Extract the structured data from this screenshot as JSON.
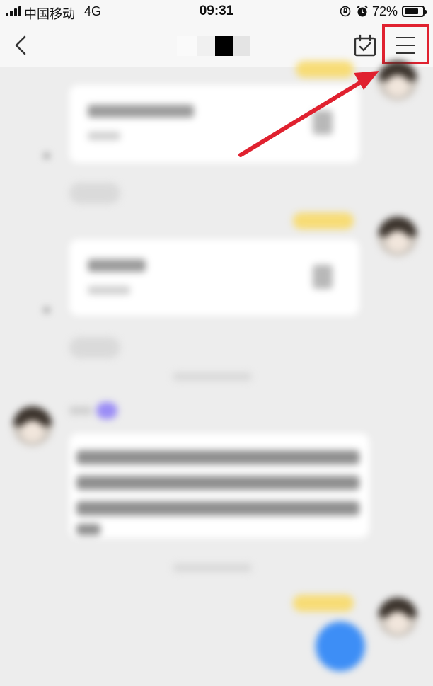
{
  "status_bar": {
    "carrier": "中国移动",
    "network": "4G",
    "time": "09:31",
    "battery": "72%",
    "battery_level": 0.72,
    "icons": [
      "signal-icon",
      "rotation-lock-icon",
      "alarm-icon",
      "battery-icon"
    ]
  },
  "nav_bar": {
    "back_icon": "chevron-left-icon",
    "calendar_icon": "calendar-check-icon",
    "menu_icon": "hamburger-menu-icon"
  },
  "colors": {
    "highlight_red": "#e0212f",
    "pill_yellow": "#f7dc76",
    "fab_blue": "#3d8ef6",
    "background": "#ededed"
  }
}
